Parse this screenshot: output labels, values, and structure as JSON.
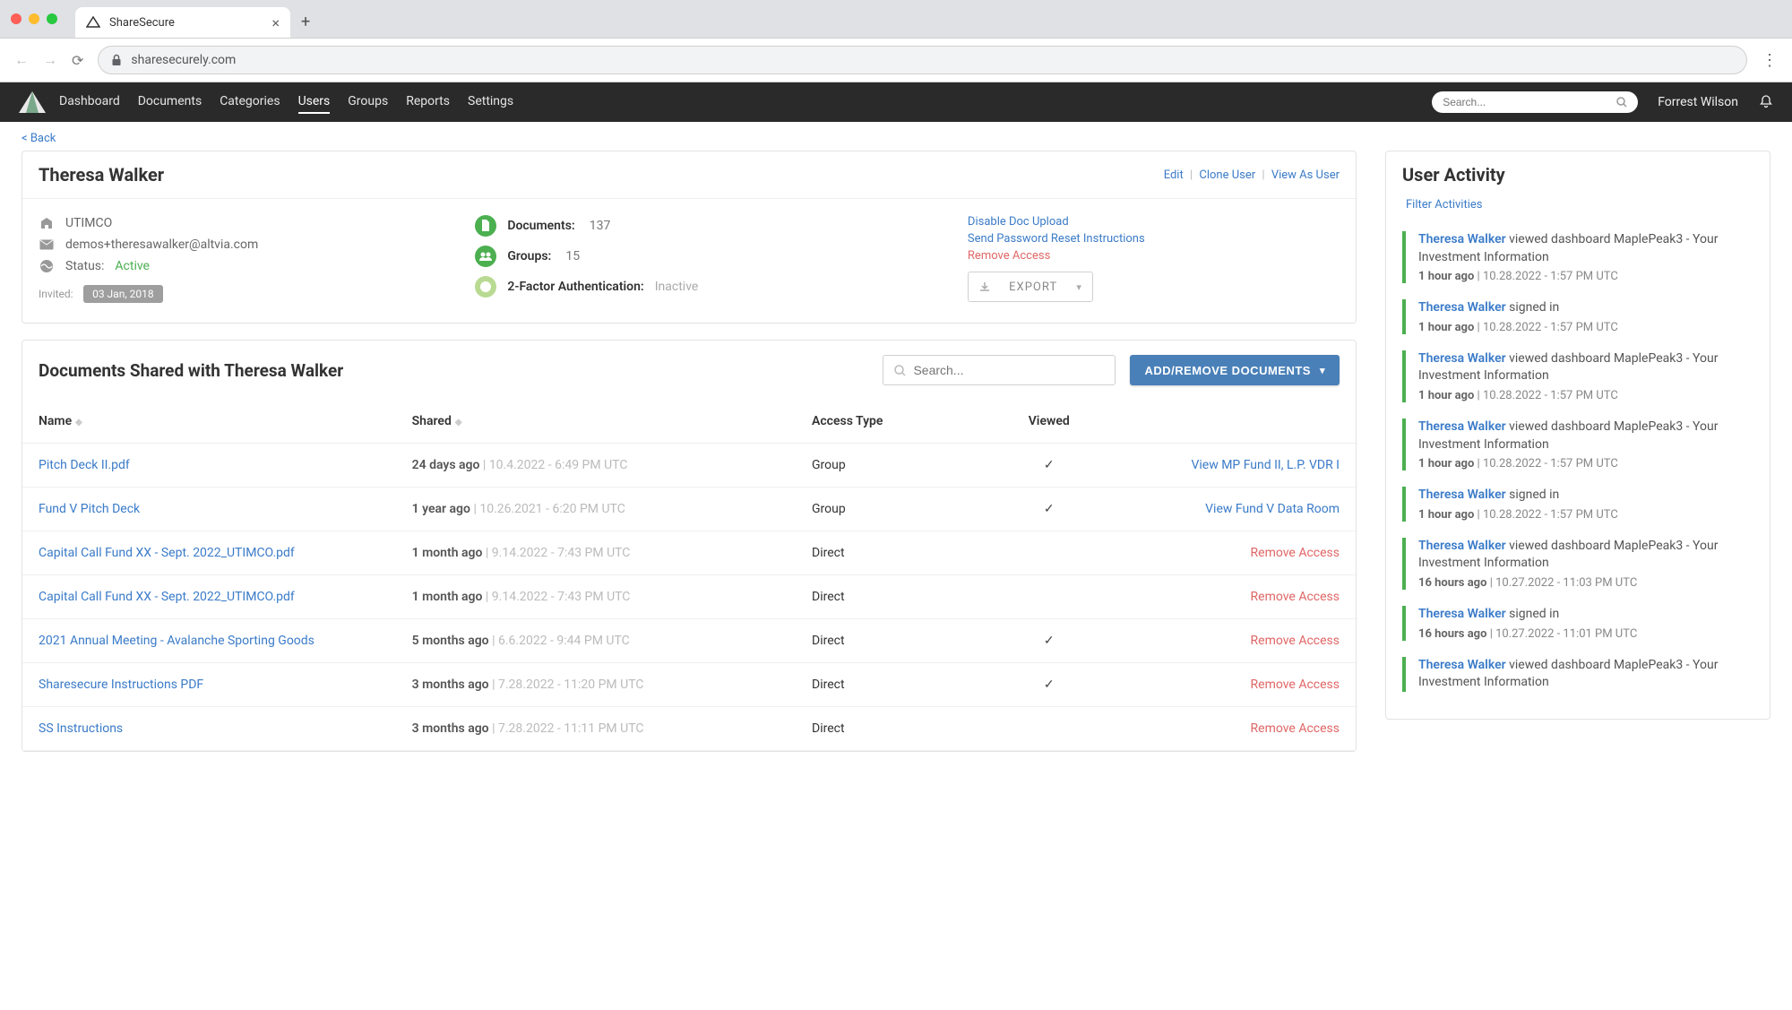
{
  "browser": {
    "tab_title": "ShareSecure",
    "url": "sharesecurely.com"
  },
  "nav": {
    "links": [
      "Dashboard",
      "Documents",
      "Categories",
      "Users",
      "Groups",
      "Reports",
      "Settings"
    ],
    "active": "Users",
    "search_placeholder": "Search...",
    "user_name": "Forrest Wilson"
  },
  "back_label": "< Back",
  "profile": {
    "name": "Theresa Walker",
    "actions": {
      "edit": "Edit",
      "clone": "Clone User",
      "view_as": "View As User"
    },
    "org": "UTIMCO",
    "email": "demos+theresawalker@altvia.com",
    "status_label": "Status:",
    "status_value": "Active",
    "invited_label": "Invited:",
    "invited_date": "03 Jan, 2018",
    "stats": {
      "documents_label": "Documents:",
      "documents_value": "137",
      "groups_label": "Groups:",
      "groups_value": "15",
      "twofa_label": "2-Factor Authentication:",
      "twofa_value": "Inactive"
    },
    "links": {
      "disable_upload": "Disable Doc Upload",
      "send_reset": "Send Password Reset Instructions",
      "remove_access": "Remove Access"
    },
    "export_label": "EXPORT"
  },
  "docs": {
    "title": "Documents Shared with Theresa Walker",
    "search_placeholder": "Search...",
    "add_btn": "ADD/REMOVE DOCUMENTS",
    "columns": {
      "name": "Name",
      "shared": "Shared",
      "access": "Access Type",
      "viewed": "Viewed"
    },
    "rows": [
      {
        "name": "Pitch Deck II.pdf",
        "ago": "24 days ago",
        "date": "10.4.2022 - 6:49 PM UTC",
        "access": "Group",
        "viewed": true,
        "action_label": "View MP Fund II, L.P. VDR I",
        "action_type": "view"
      },
      {
        "name": "Fund V Pitch Deck",
        "ago": "1 year ago",
        "date": "10.26.2021 - 6:20 PM UTC",
        "access": "Group",
        "viewed": true,
        "action_label": "View Fund V Data Room",
        "action_type": "view"
      },
      {
        "name": "Capital Call Fund XX - Sept. 2022_UTIMCO.pdf",
        "ago": "1 month ago",
        "date": "9.14.2022 - 7:43 PM UTC",
        "access": "Direct",
        "viewed": false,
        "action_label": "Remove Access",
        "action_type": "remove"
      },
      {
        "name": "Capital Call Fund XX - Sept. 2022_UTIMCO.pdf",
        "ago": "1 month ago",
        "date": "9.14.2022 - 7:43 PM UTC",
        "access": "Direct",
        "viewed": false,
        "action_label": "Remove Access",
        "action_type": "remove"
      },
      {
        "name": "2021 Annual Meeting - Avalanche Sporting Goods",
        "ago": "5 months ago",
        "date": "6.6.2022 - 9:44 PM UTC",
        "access": "Direct",
        "viewed": true,
        "action_label": "Remove Access",
        "action_type": "remove"
      },
      {
        "name": "Sharesecure Instructions PDF",
        "ago": "3 months ago",
        "date": "7.28.2022 - 11:20 PM UTC",
        "access": "Direct",
        "viewed": true,
        "action_label": "Remove Access",
        "action_type": "remove"
      },
      {
        "name": "SS Instructions",
        "ago": "3 months ago",
        "date": "7.28.2022 - 11:11 PM UTC",
        "access": "Direct",
        "viewed": false,
        "action_label": "Remove Access",
        "action_type": "remove"
      }
    ]
  },
  "activity": {
    "title": "User Activity",
    "filter_label": "Filter Activities",
    "items": [
      {
        "who": "Theresa Walker",
        "text": "viewed dashboard MaplePeak3 - Your Investment Information",
        "ago": "1 hour ago",
        "ts": "10.28.2022 - 1:57 PM UTC"
      },
      {
        "who": "Theresa Walker",
        "text": "signed in",
        "ago": "1 hour ago",
        "ts": "10.28.2022 - 1:57 PM UTC"
      },
      {
        "who": "Theresa Walker",
        "text": "viewed dashboard MaplePeak3 - Your Investment Information",
        "ago": "1 hour ago",
        "ts": "10.28.2022 - 1:57 PM UTC"
      },
      {
        "who": "Theresa Walker",
        "text": "viewed dashboard MaplePeak3 - Your Investment Information",
        "ago": "1 hour ago",
        "ts": "10.28.2022 - 1:57 PM UTC"
      },
      {
        "who": "Theresa Walker",
        "text": "signed in",
        "ago": "1 hour ago",
        "ts": "10.28.2022 - 1:57 PM UTC"
      },
      {
        "who": "Theresa Walker",
        "text": "viewed dashboard MaplePeak3 - Your Investment Information",
        "ago": "16 hours ago",
        "ts": "10.27.2022 - 11:03 PM UTC"
      },
      {
        "who": "Theresa Walker",
        "text": "signed in",
        "ago": "16 hours ago",
        "ts": "10.27.2022 - 11:01 PM UTC"
      },
      {
        "who": "Theresa Walker",
        "text": "viewed dashboard MaplePeak3 - Your Investment Information",
        "ago": "",
        "ts": ""
      }
    ]
  }
}
